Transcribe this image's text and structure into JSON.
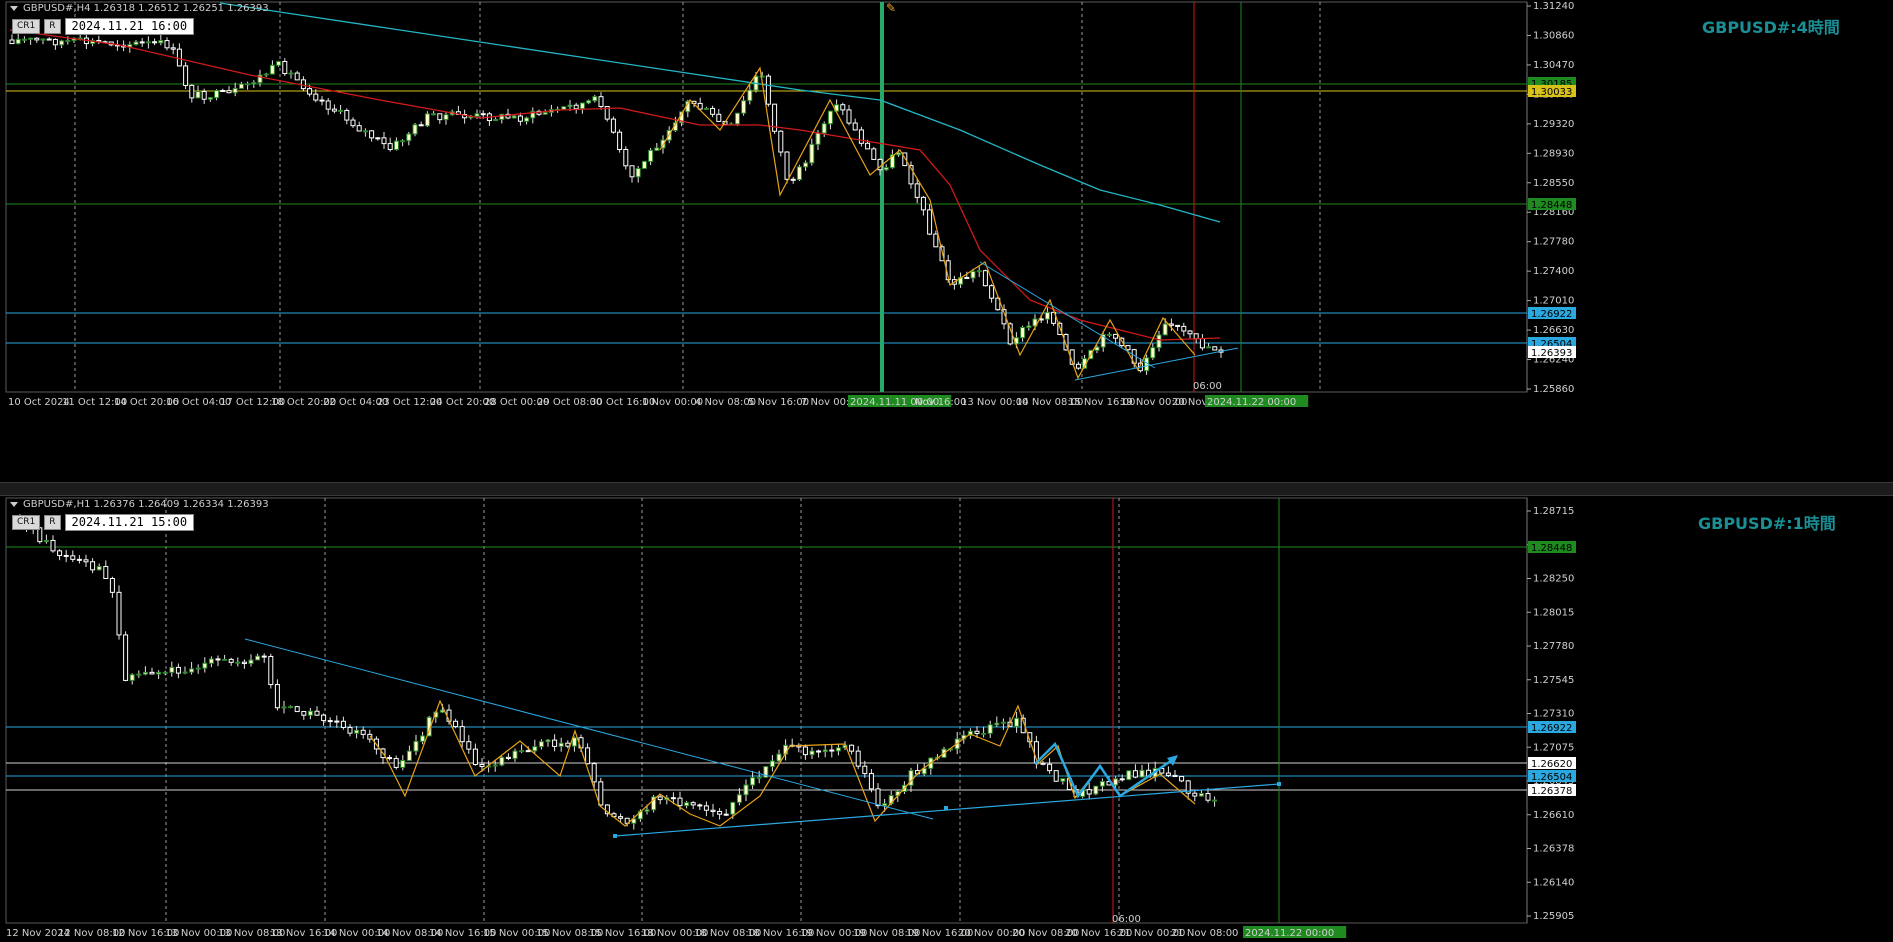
{
  "colors": {
    "background": "#000000",
    "candle_up": "#ffffcc",
    "candle_down": "#ffffff",
    "zigzag": "#e8a317",
    "ma_fast": "#d11a1a",
    "ma_slow": "#23b6c4",
    "trendline": "#2aa8e0",
    "hline_blue": "#2aa8e0",
    "hline_green": "#1f8a1f",
    "hline_yellow": "#d8c21a",
    "hline_white": "#cfcfcf",
    "vline_red": "#d11a1a",
    "vline_green": "#1f8a1f",
    "tf_label": "#1a8f95"
  },
  "top_panel": {
    "symbol_line": "GBPUSD#,H4  1.26318 1.26512 1.26251 1.26393",
    "cr_label": "CR1",
    "r_label": "R",
    "time_field": "2024.11.21 16:00",
    "timeframe_label": "GBPUSD#:4時間",
    "marker_label": "06:00",
    "x_labels": [
      "10 Oct 2024",
      "11 Oct 12:00",
      "14 Oct 20:00",
      "16 Oct 04:00",
      "17 Oct 12:00",
      "18 Oct 20:00",
      "22 Oct 04:00",
      "23 Oct 12:00",
      "24 Oct 20:00",
      "28 Oct 00:00",
      "29 Oct 08:00",
      "30 Oct 16:00",
      "1 Nov 00:00",
      "4 Nov 08:00",
      "5 Nov 16:00",
      "7 Nov 00:00",
      "2024.11.11 00:00",
      "Nov 16:00",
      "13 Nov 00:00",
      "14 Nov 08:00",
      "15 Nov 16:00",
      "19 Nov 00:00",
      "20 Nov 0",
      "2024.11.22 00:00"
    ],
    "y_labels": [
      "1.31240",
      "1.30860",
      "1.30470",
      "1.29700",
      "1.29320",
      "1.28930",
      "1.28550",
      "1.28160",
      "1.27780",
      "1.27400",
      "1.27010",
      "1.26630",
      "1.26240",
      "1.25860"
    ],
    "price_tags": [
      {
        "text": "1.30185",
        "color": "#1f8a1f",
        "text_color": "#000000"
      },
      {
        "text": "1.30033",
        "color": "#d8c21a",
        "text_color": "#000000"
      },
      {
        "text": "1.28448",
        "color": "#1f8a1f",
        "text_color": "#000000"
      },
      {
        "text": "1.26922",
        "color": "#2aa8e0",
        "text_color": "#000000"
      },
      {
        "text": "1.26504",
        "color": "#2aa8e0",
        "text_color": "#000000"
      },
      {
        "text": "1.26393",
        "color": "#ffffff",
        "text_color": "#000000"
      }
    ]
  },
  "bottom_panel": {
    "symbol_line": "GBPUSD#,H1  1.26376 1.26409 1.26334 1.26393",
    "cr_label": "CR1",
    "r_label": "R",
    "time_field": "2024.11.21 15:00",
    "timeframe_label": "GBPUSD#:1時間",
    "marker_label": "06:00",
    "x_labels": [
      "12 Nov 2024",
      "12 Nov 08:00",
      "12 Nov 16:00",
      "13 Nov 00:00",
      "13 Nov 08:00",
      "13 Nov 16:00",
      "14 Nov 00:00",
      "14 Nov 08:00",
      "14 Nov 16:00",
      "15 Nov 00:00",
      "15 Nov 08:00",
      "15 Nov 16:00",
      "18 Nov 00:00",
      "18 Nov 08:00",
      "18 Nov 16:00",
      "19 Nov 00:00",
      "19 Nov 08:00",
      "19 Nov 16:00",
      "20 Nov 00:00",
      "20 Nov 08:00",
      "20 Nov 16:00",
      "21 Nov 00:00",
      "21 Nov 08:00",
      "2024.11.22 00:00"
    ],
    "y_labels": [
      "1.28715",
      "1.28480",
      "1.28250",
      "1.28015",
      "1.27780",
      "1.27545",
      "1.27310",
      "1.27075",
      "1.26845",
      "1.26610",
      "1.26378",
      "1.26140",
      "1.25905"
    ],
    "price_tags": [
      {
        "text": "1.28448",
        "color": "#1f8a1f",
        "text_color": "#000000"
      },
      {
        "text": "1.26922",
        "color": "#2aa8e0",
        "text_color": "#000000"
      },
      {
        "text": "1.26620",
        "color": "#ffffff",
        "text_color": "#000000"
      },
      {
        "text": "1.26504",
        "color": "#2aa8e0",
        "text_color": "#000000"
      },
      {
        "text": "1.26378",
        "color": "#ffffff",
        "text_color": "#000000"
      }
    ]
  }
}
